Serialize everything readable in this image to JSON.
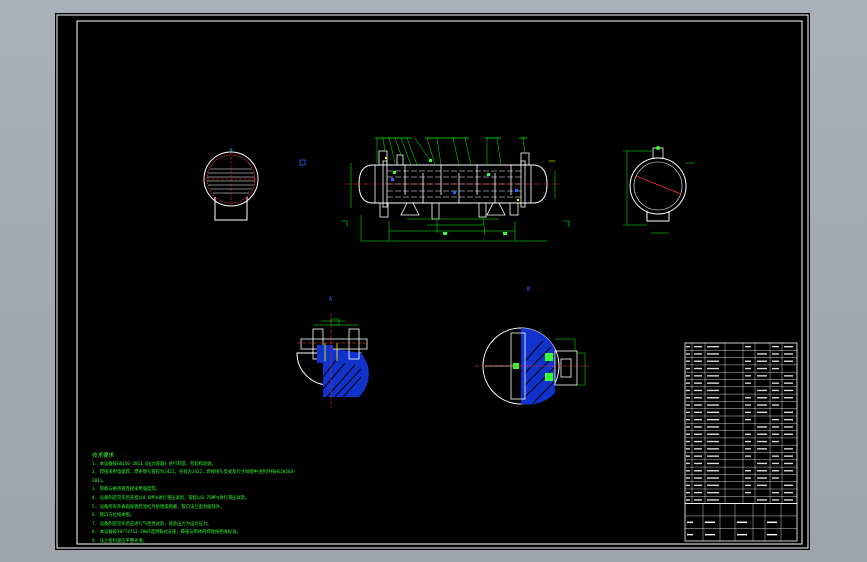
{
  "drawing": {
    "technical_requirements_title": "技术要求",
    "technical_requirements": [
      "1. 本设备按GB150-2011《压力容器》进行制造、检验和验收。",
      "2. 焊接采用电弧焊，焊条牌号管程为J422，壳程为J422，焊接接头型式及尺寸除图中注明外按HG20583-2011。",
      "3. 管板与换热管连接采用强度焊。",
      "4. 设备制造完毕后壳程以0.6MPa进行液压试验，管程以0.75MPa进行液压试验。",
      "5. 设备所有外表面除锈后涂红丹防锈漆两遍，管口法兰密封面除外。",
      "6. 管口方位按本图。",
      "7. 设备制造完毕后应进行气密性试验，试验压力为设计压力。",
      "8. 本设备按JB/T4712-2007选用鞍式支座，鞍座与筒体的焊接按相关标准。",
      "9. 法兰密封面应平整光滑。"
    ],
    "section_marks": [
      "A",
      "B"
    ],
    "colors": {
      "border": "#ffffff",
      "outline": "#ffffff",
      "dimension": "#00ff00",
      "centerline": "#ff3333",
      "hatch": "#2244ff",
      "nozzle": "#ffff00",
      "leader": "#00ffff",
      "tube_sheet": "#33ff33"
    }
  }
}
